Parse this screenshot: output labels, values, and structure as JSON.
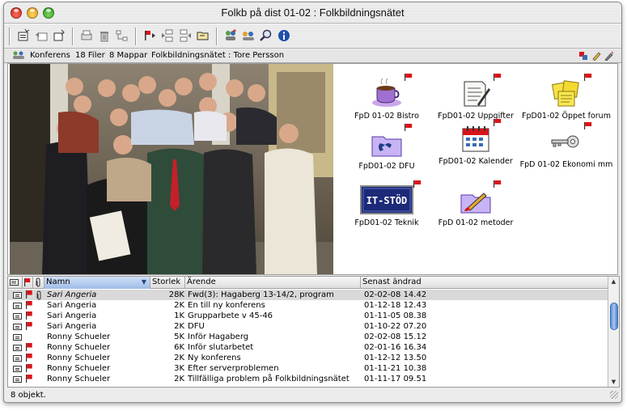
{
  "window": {
    "title": "Folkb på dist 01-02 : Folkbildningsnätet"
  },
  "toolbar": {
    "buttons": [
      "new-document-icon",
      "reply-icon",
      "copy-icon",
      "print-icon",
      "trash-icon",
      "tree-icon",
      "flag-next-icon",
      "prev-thread-icon",
      "next-thread-icon",
      "folder-open-icon",
      "add-users-icon",
      "people-icon",
      "search-icon",
      "info-icon"
    ]
  },
  "status": {
    "section": "Konferens",
    "files": "18 Filer",
    "folders": "8 Mappar",
    "path": "Folkbildningsnätet : Tore Persson"
  },
  "folders": [
    {
      "label": "FpD 01-02 Bistro",
      "icon": "coffee-cup-icon"
    },
    {
      "label": "FpD01-02 Uppgifter",
      "icon": "document-quill-icon"
    },
    {
      "label": "FpD01-02 Öppet forum",
      "icon": "sticky-notes-icon"
    },
    {
      "label": "FpD01-02 DFU",
      "icon": "telephone-folder-icon"
    },
    {
      "label": "FpD01-02 Kalender",
      "icon": "calendar-icon"
    },
    {
      "label": "FpD 01-02 Ekonomi mm",
      "icon": "key-icon"
    },
    {
      "label": "FpD01-02 Teknik",
      "icon": "it-stod-icon",
      "badge": "IT-STÖD"
    },
    {
      "label": "FpD 01-02 metoder",
      "icon": "brush-folder-icon"
    }
  ],
  "list": {
    "columns": {
      "name": "Namn",
      "size": "Storlek",
      "subject": "Ärende",
      "modified": "Senast ändrad"
    },
    "rows": [
      {
        "name": "Sari Angeria",
        "size": "28K",
        "subject": "Fwd(3): Hagaberg 13-14/2, program",
        "modified": "02-02-08  14.42",
        "flag": true,
        "attach": true,
        "selected": true
      },
      {
        "name": "Sari Angeria",
        "size": "2K",
        "subject": "En till ny konferens",
        "modified": "01-12-18  12.43",
        "flag": true,
        "attach": false,
        "selected": false
      },
      {
        "name": "Sari Angeria",
        "size": "1K",
        "subject": "Grupparbete v 45-46",
        "modified": "01-11-05  08.38",
        "flag": true,
        "attach": false,
        "selected": false
      },
      {
        "name": "Sari Angeria",
        "size": "2K",
        "subject": "DFU",
        "modified": "01-10-22  07.20",
        "flag": true,
        "attach": false,
        "selected": false
      },
      {
        "name": "Ronny Schueler",
        "size": "5K",
        "subject": "Inför Hagaberg",
        "modified": "02-02-08  15.12",
        "flag": false,
        "attach": false,
        "selected": false
      },
      {
        "name": "Ronny Schueler",
        "size": "6K",
        "subject": "Inför slutarbetet",
        "modified": "02-01-16  16.34",
        "flag": true,
        "attach": false,
        "selected": false
      },
      {
        "name": "Ronny Schueler",
        "size": "2K",
        "subject": "Ny konferens",
        "modified": "01-12-12  13.50",
        "flag": true,
        "attach": false,
        "selected": false
      },
      {
        "name": "Ronny Schueler",
        "size": "3K",
        "subject": "Efter serverproblemen",
        "modified": "01-11-21  10.38",
        "flag": true,
        "attach": false,
        "selected": false
      },
      {
        "name": "Ronny Schueler",
        "size": "2K",
        "subject": "Tillfälliga problem på Folkbildningsnätet",
        "modified": "01-11-17  09.51",
        "flag": true,
        "attach": false,
        "selected": false
      }
    ]
  },
  "footer": {
    "count": "8 objekt."
  },
  "colors": {
    "accent": "#3c6bb4",
    "flag": "#d8141a",
    "selection": "#d9d9d9"
  }
}
